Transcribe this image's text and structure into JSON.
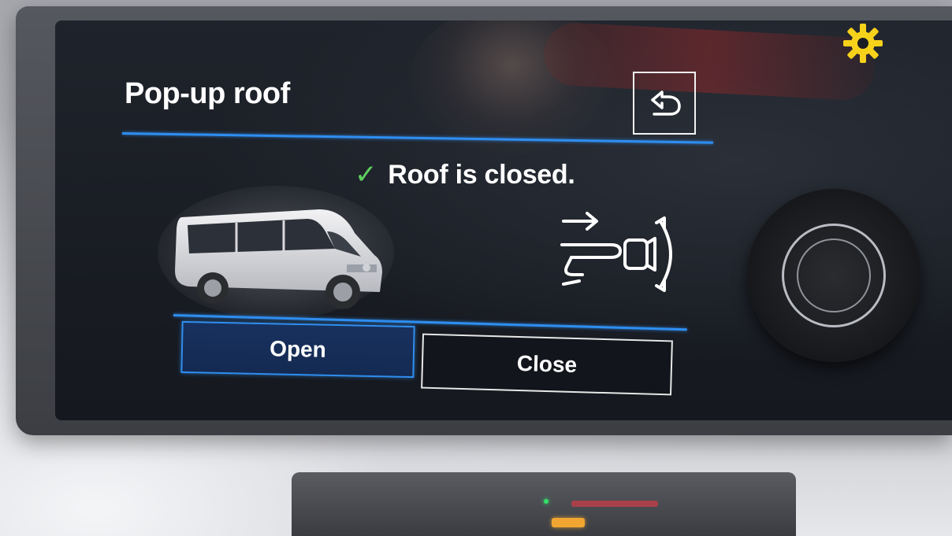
{
  "header": {
    "title": "Pop-up roof",
    "back_icon": "back-arrow-icon"
  },
  "status": {
    "icon": "check-icon",
    "text": "Roof is closed.",
    "check_glyph": "✓"
  },
  "illustrations": {
    "vehicle": "van-image",
    "gesture": "swipe-gesture-icon"
  },
  "actions": {
    "open_label": "Open",
    "close_label": "Close"
  },
  "indicators": {
    "warning_icon": "gear-icon"
  },
  "colors": {
    "accent": "#2f8ef0",
    "check": "#5fd15f",
    "warning": "#f7d21a",
    "text": "#ffffff",
    "screen_bg": "#1a1d23"
  }
}
